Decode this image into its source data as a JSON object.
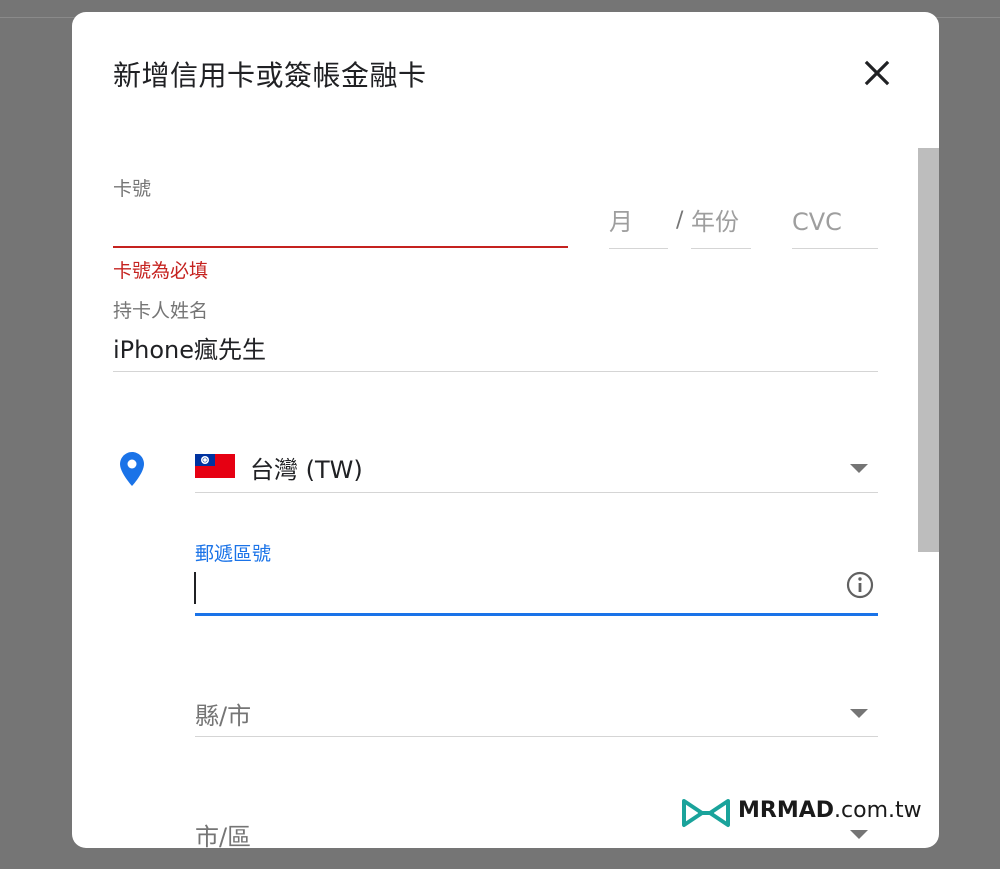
{
  "dialog": {
    "title": "新增信用卡或簽帳金融卡"
  },
  "card": {
    "number_label": "卡號",
    "number_value": "",
    "number_error": "卡號為必填",
    "month_placeholder": "月",
    "separator": "/",
    "year_placeholder": "年份",
    "cvc_placeholder": "CVC"
  },
  "cardholder": {
    "label": "持卡人姓名",
    "value": "iPhone瘋先生"
  },
  "address": {
    "country_value": "台灣 (TW)",
    "postal_label": "郵遞區號",
    "postal_value": "",
    "county_placeholder": "縣/市",
    "district_placeholder": "市/區"
  },
  "watermark": {
    "brand": "MRMAD",
    "domain": ".com.tw"
  },
  "colors": {
    "error": "#c5221f",
    "accent": "#1a73e8",
    "watermark_logo": "#1aa39b"
  },
  "icons": {
    "close": "close-icon",
    "location": "location-pin-icon",
    "flag": "taiwan-flag-icon",
    "info": "info-icon",
    "dropdown": "chevron-down-icon"
  }
}
